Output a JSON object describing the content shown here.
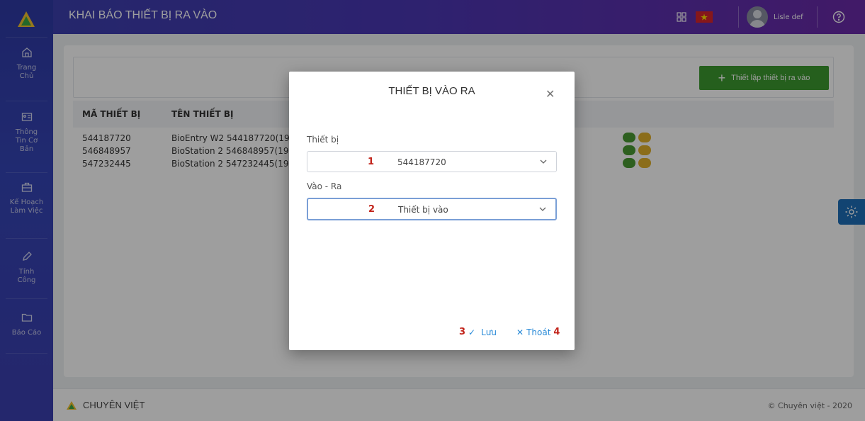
{
  "header": {
    "title": "KHAI BÁO THIẾT BỊ RA VÀO",
    "username": "Lisle def"
  },
  "sidebar": {
    "items": [
      {
        "label": "Trang\nChủ",
        "icon": "home-icon"
      },
      {
        "label": "Thông\nTin Cơ\nBản",
        "icon": "id-card-icon"
      },
      {
        "label": "Kế Hoạch\nLàm Việc",
        "icon": "briefcase-icon"
      },
      {
        "label": "Tính\nCông",
        "icon": "pencil-icon"
      },
      {
        "label": "Báo Cáo",
        "icon": "folder-icon"
      }
    ]
  },
  "toolbar": {
    "add_label": "Thiết lập thiết bị ra vào"
  },
  "table": {
    "headers": [
      "MÃ THIẾT BỊ",
      "TÊN THIẾT BỊ"
    ],
    "rows": [
      {
        "code": "544187720",
        "name": "BioEntry W2 544187720(192"
      },
      {
        "code": "546848957",
        "name": "BioStation 2 546848957(192"
      },
      {
        "code": "547232445",
        "name": "BioStation 2 547232445(192"
      }
    ]
  },
  "modal": {
    "title": "THIẾT BỊ VÀO RA",
    "device_label": "Thiết bị",
    "device_step": "1",
    "device_value": "544187720",
    "direction_label": "Vào - Ra",
    "direction_step": "2",
    "direction_value": "Thiết bị vào",
    "save_step": "3",
    "save_label": "Lưu",
    "exit_label": "Thoát",
    "exit_step": "4"
  },
  "footer": {
    "brand": "CHUYÊN VIỆT",
    "copyright": "© Chuyên việt - 2020"
  },
  "colors": {
    "primary": "#3c3faf",
    "add_green": "#3c9a2f",
    "link_blue": "#2a8bd8",
    "step_red": "#c2241b"
  }
}
